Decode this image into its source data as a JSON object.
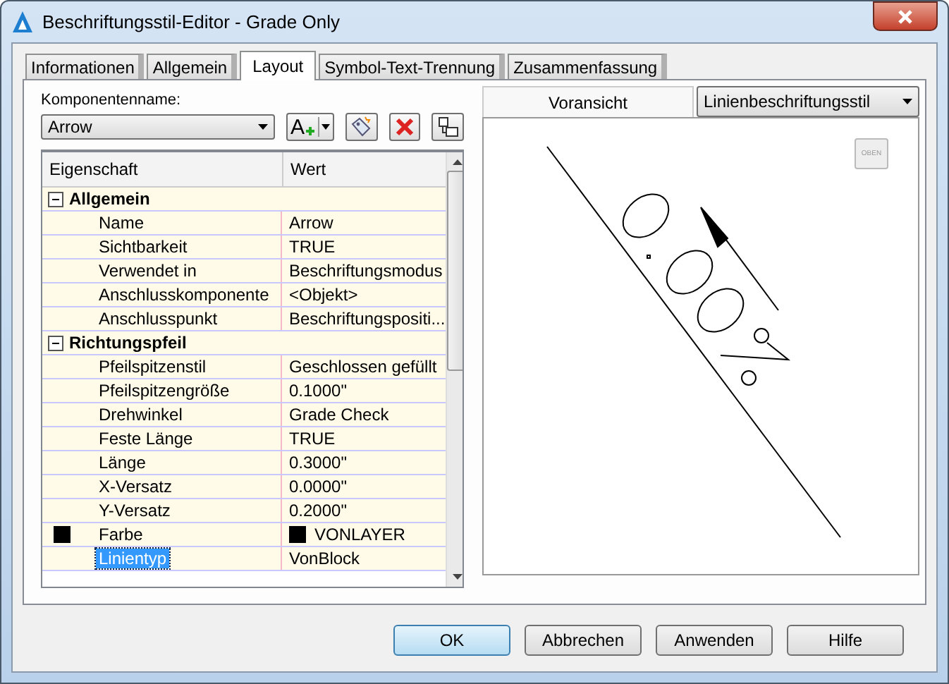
{
  "window": {
    "title": "Beschriftungsstil-Editor - Grade Only"
  },
  "tabs": [
    {
      "label": "Informationen",
      "selected": false
    },
    {
      "label": "Allgemein",
      "selected": false
    },
    {
      "label": "Layout",
      "selected": true
    },
    {
      "label": "Symbol-Text-Trennung",
      "selected": false
    },
    {
      "label": "Zusammenfassung",
      "selected": false
    }
  ],
  "component": {
    "label": "Komponentenname:",
    "value": "Arrow",
    "add_text_glyph": "A"
  },
  "property_grid": {
    "columns": [
      "Eigenschaft",
      "Wert"
    ],
    "groups": [
      {
        "name": "Allgemein",
        "expanded": true,
        "rows": [
          {
            "name": "Name",
            "value": "Arrow",
            "selected": false
          },
          {
            "name": "Sichtbarkeit",
            "value": "TRUE",
            "selected": false
          },
          {
            "name": "Verwendet in",
            "value": "Beschriftungsmodus",
            "selected": false
          },
          {
            "name": "Anschlusskomponente",
            "value": "<Objekt>",
            "selected": false
          },
          {
            "name": "Anschlusspunkt",
            "value": "Beschriftungspositi...",
            "selected": false
          }
        ]
      },
      {
        "name": "Richtungspfeil",
        "expanded": true,
        "rows": [
          {
            "name": "Pfeilspitzenstil",
            "value": "Geschlossen gefüllt",
            "selected": false
          },
          {
            "name": "Pfeilspitzengröße",
            "value": "0.1000\"",
            "selected": false
          },
          {
            "name": "Drehwinkel",
            "value": "Grade Check",
            "selected": false
          },
          {
            "name": "Feste Länge",
            "value": "TRUE",
            "selected": false
          },
          {
            "name": "Länge",
            "value": "0.3000\"",
            "selected": false
          },
          {
            "name": "X-Versatz",
            "value": "0.0000\"",
            "selected": false
          },
          {
            "name": "Y-Versatz",
            "value": "0.2000\"",
            "selected": false
          },
          {
            "name": "Farbe",
            "value": "VONLAYER",
            "selected": false,
            "color": "#000000"
          },
          {
            "name": "Linientyp",
            "value": "VonBlock",
            "selected": true
          }
        ]
      }
    ]
  },
  "preview": {
    "label": "Voransicht",
    "style_select": "Linienbeschriftungsstil",
    "view_button": "OBEN"
  },
  "buttons": [
    {
      "label": "OK",
      "default": true
    },
    {
      "label": "Abbrechen",
      "default": false
    },
    {
      "label": "Anwenden",
      "default": false
    },
    {
      "label": "Hilfe",
      "default": false
    }
  ]
}
